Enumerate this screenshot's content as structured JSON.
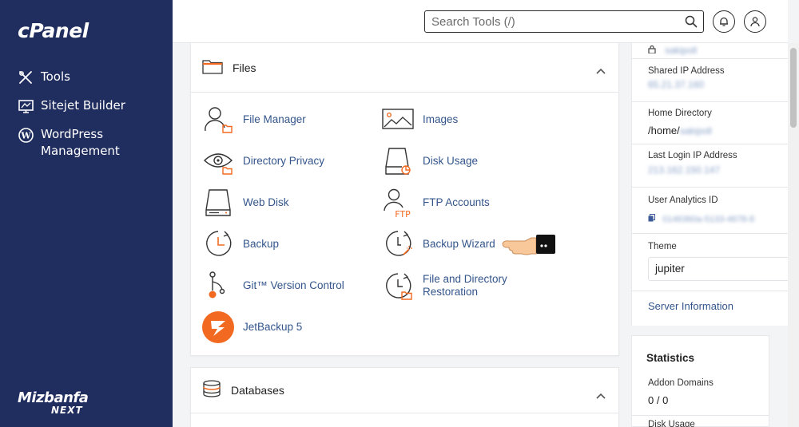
{
  "sidebar": {
    "logo": "cPanel",
    "items": [
      {
        "label": "Tools",
        "icon": "tools-icon"
      },
      {
        "label": "Sitejet Builder",
        "icon": "sitejet-icon"
      },
      {
        "label": "WordPress Management",
        "icon": "wordpress-icon"
      }
    ],
    "brand_line1": "Mizbanfa",
    "brand_line2": "NEXT"
  },
  "topbar": {
    "search_placeholder": "Search Tools (/)"
  },
  "files_panel": {
    "title": "Files",
    "tools": [
      {
        "label": "File Manager"
      },
      {
        "label": "Images"
      },
      {
        "label": "Directory Privacy"
      },
      {
        "label": "Disk Usage"
      },
      {
        "label": "Web Disk"
      },
      {
        "label": "FTP Accounts"
      },
      {
        "label": "Backup"
      },
      {
        "label": "Backup Wizard"
      },
      {
        "label": "Git™ Version Control"
      },
      {
        "label": "File and Directory Restoration"
      },
      {
        "label": "JetBackup 5"
      }
    ]
  },
  "databases_panel": {
    "title": "Databases"
  },
  "info": {
    "username_value": "sakipoll",
    "shared_ip_label": "Shared IP Address",
    "shared_ip_value": "65.21.37.160",
    "home_dir_label": "Home Directory",
    "home_dir_prefix": "/home/",
    "home_dir_user": "sakipoll",
    "last_login_label": "Last Login IP Address",
    "last_login_value": "213.162.150.147",
    "analytics_label": "User Analytics ID",
    "analytics_value": "0146360a-5133-4678-8",
    "theme_label": "Theme",
    "theme_value": "jupiter",
    "server_info_link": "Server Information"
  },
  "stats": {
    "title": "Statistics",
    "addon_label": "Addon Domains",
    "addon_value": "0 / 0",
    "disk_label": "Disk Usage"
  },
  "colors": {
    "sidebar_bg": "#202d5f",
    "link": "#33558b",
    "accent_orange": "#f26a21"
  }
}
